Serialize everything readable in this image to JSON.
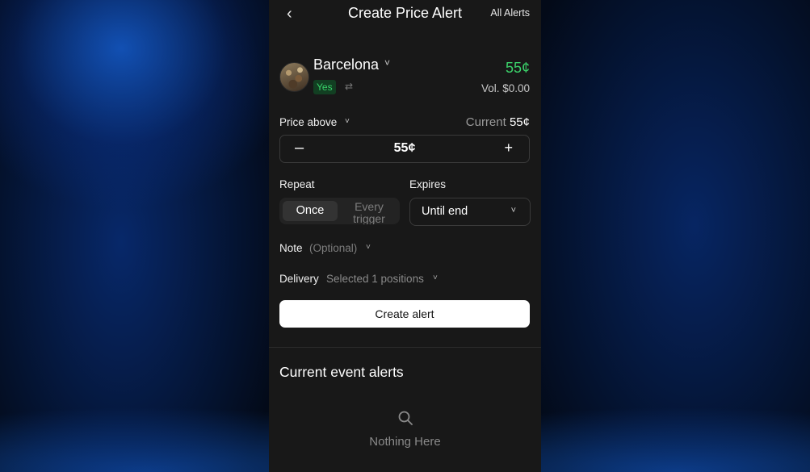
{
  "header": {
    "back_icon": "chevron-left-icon",
    "back_glyph": "‹",
    "title": "Create Price Alert",
    "all_alerts": "All Alerts"
  },
  "market": {
    "name": "Barcelona",
    "chevron": "˅",
    "outcome": "Yes",
    "swap_glyph": "⇄",
    "price": "55¢",
    "volume": "Vol. $0.00",
    "colors": {
      "price": "#3bd26a",
      "yes_bg": "#123f22"
    }
  },
  "condition": {
    "label": "Price above",
    "chevron": "˅",
    "current_label": "Current",
    "current_value": "55¢"
  },
  "stepper": {
    "minus": "–",
    "value": "55¢",
    "plus": "+"
  },
  "repeat": {
    "label": "Repeat",
    "options": [
      "Once",
      "Every trigger"
    ],
    "selected": "Once"
  },
  "expires": {
    "label": "Expires",
    "value": "Until end",
    "chevron": "˅"
  },
  "note": {
    "label": "Note",
    "optional": "(Optional)",
    "chevron": "˅"
  },
  "delivery": {
    "label": "Delivery",
    "value": "Selected 1 positions",
    "chevron": "˅"
  },
  "create_button": "Create alert",
  "current_alerts": {
    "title": "Current event alerts",
    "empty_icon": "search-icon",
    "empty_text": "Nothing Here"
  }
}
